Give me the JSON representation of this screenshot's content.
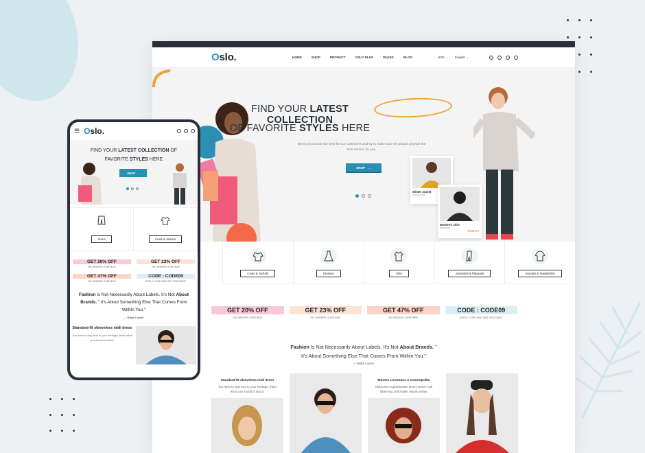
{
  "brand": {
    "logo": "Oslo.",
    "accent": "#2a8fb2",
    "highlight": "#f0a23a"
  },
  "desktop": {
    "menu": [
      "HOME",
      "SHOP",
      "PRODUCT",
      "OSLO PLUS",
      "PAGES",
      "BLOG"
    ],
    "currency": "USD",
    "language": "English",
    "hero": {
      "line1_pre": "FIND YOUR",
      "line1_bold": "LATEST",
      "line1_hl": "COLLECTION",
      "line2_pre": "OF FAVORITE",
      "line2_bold": "STYLES",
      "line2_post": "HERE",
      "description": "We try to provide the best for our customers and try to make sure we always provide the best service for you.",
      "button": "SHOP",
      "cards": [
        {
          "name": "Winter Jacket",
          "sub": "Hoody Style",
          "price": ""
        },
        {
          "name": "Women's shirt",
          "sub": "Elements",
          "price": "$198.00"
        }
      ]
    },
    "categories": [
      "Coats & Jackets",
      "Dresses",
      "Shirt",
      "Jumpsuits & Playsuits",
      "Hoodies & Sweatshirts"
    ],
    "coupons": [
      {
        "code": "GET 20% OFF",
        "desc": "ON ORDERS OVER $20*",
        "color": "#f8c9d7"
      },
      {
        "code": "GET 23% OFF",
        "desc": "ON ORDERS OVER $45*",
        "color": "#fbe3d6"
      },
      {
        "code": "GET 47% OFF",
        "desc": "ON ORDERS OVER $99*",
        "color": "#fcd3c8"
      },
      {
        "code": "CODE : CODE09",
        "desc": "APPLY CODE AND GET DISCOUNT",
        "color": "#dceef5"
      }
    ],
    "quote": {
      "w1": "Fashion",
      "w2": "Is Not Necessarily About Labels. It's Not",
      "w3": "About Brands.",
      "w4": "\"",
      "line2": "It's About Something Else That Comes From Within You.\"",
      "author": "Ralph Lauren"
    },
    "products": [
      {
        "title": "Standard-fit sleeveless midi dress",
        "desc": "You have to stay true to your heritage; that's what your brand is about."
      },
      {
        "title": "",
        "desc": ""
      },
      {
        "title": "Montes Leromous A Cosmopolite",
        "desc": "Statement sophistication jersey-based midi flattering comfortable details yellow."
      },
      {
        "title": "",
        "desc": ""
      }
    ]
  },
  "mobile": {
    "logo": "Oslo.",
    "hero": {
      "line1": "FIND YOUR",
      "line1_bold": "LATEST",
      "line1_hl": "COLLECTION",
      "line1_post": "OF",
      "line2_pre": "FAVORITE",
      "line2_bold": "STYLES",
      "line2_post": "HERE",
      "button": "SHOP"
    },
    "categories": [
      "Jeans",
      "Coats & Jackets"
    ],
    "coupons": [
      {
        "code": "GET 20% OFF",
        "desc": "ON ORDERS OVER $20*",
        "color": "#f8c9d7"
      },
      {
        "code": "GET 23% OFF",
        "desc": "ON ORDERS OVER $45*",
        "color": "#fbe3d6"
      },
      {
        "code": "GET 47% OFF",
        "desc": "ON ORDERS OVER $99*",
        "color": "#fcd3c8"
      },
      {
        "code": "CODE : CODE09",
        "desc": "APPLY CODE AND GET DISCOUNT",
        "color": "#dceef5"
      }
    ],
    "quote": {
      "w1": "Fashion",
      "w2": "Is Not Necessarily About Labels. It's Not",
      "w3": "About",
      "w4": "Brands.",
      "w5": "\" It's About Something Else That Comes From Within You.\"",
      "author": "Ralph Lauren"
    },
    "product": {
      "title": "Standard-fit sleeveless midi dress",
      "desc": "You have to stay true to your heritage; that's what your brand is about."
    }
  }
}
